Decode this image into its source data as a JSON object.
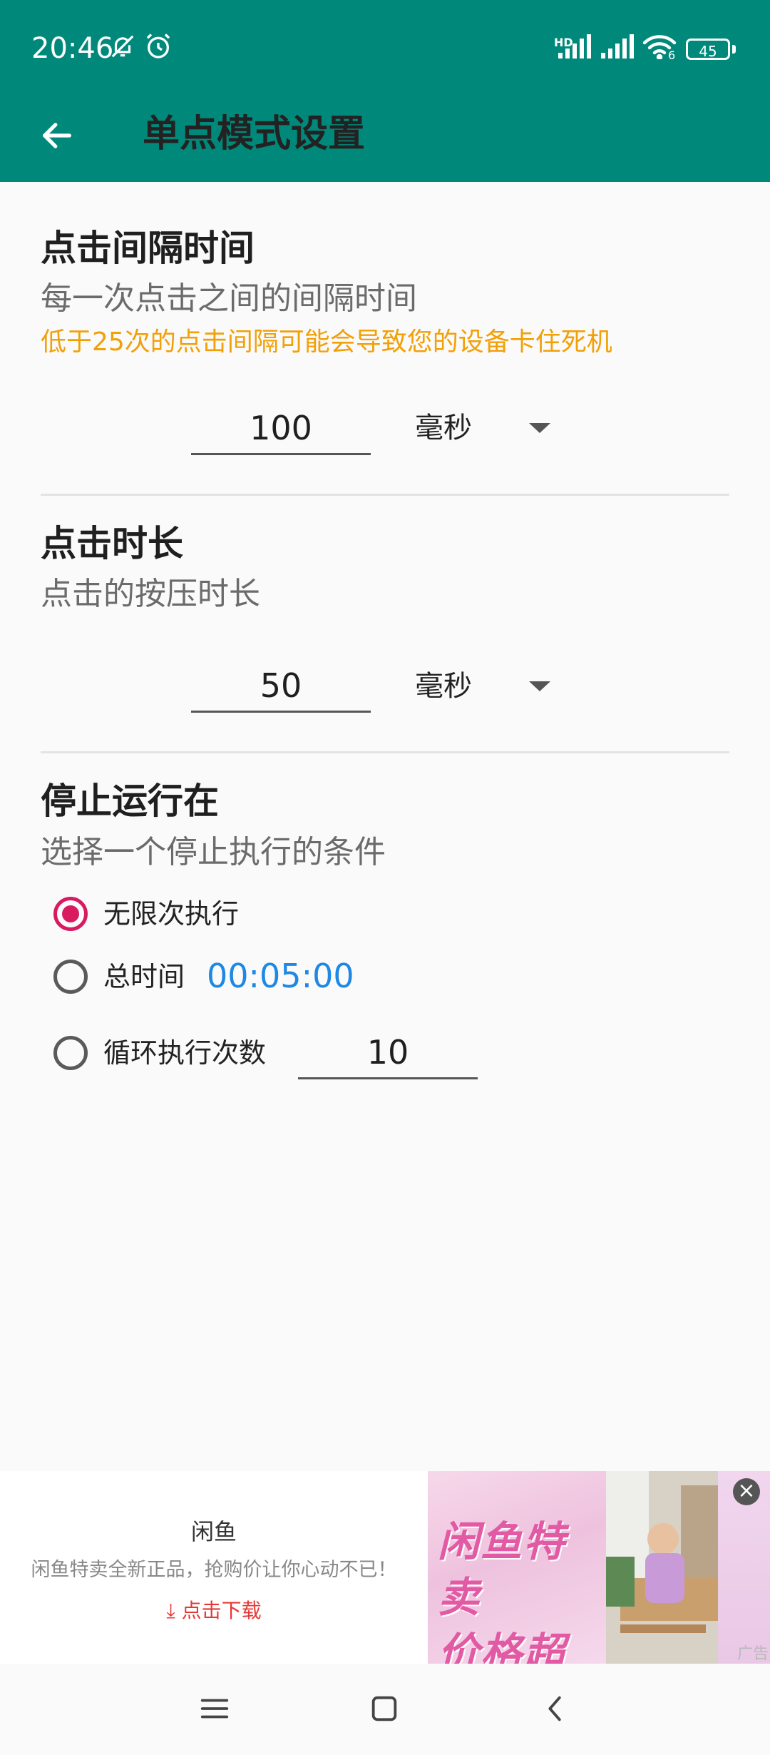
{
  "status_bar": {
    "time": "20:46",
    "battery": "45",
    "hd": "HD",
    "wifi_badge": "6"
  },
  "app_bar": {
    "title": "单点模式设置"
  },
  "interval": {
    "title": "点击间隔时间",
    "subtitle": "每一次点击之间的间隔时间",
    "warning": "低于25次的点击间隔可能会导致您的设备卡住死机",
    "value": "100",
    "unit": "毫秒"
  },
  "duration": {
    "title": "点击时长",
    "subtitle": "点击的按压时长",
    "value": "50",
    "unit": "毫秒"
  },
  "stop": {
    "title": "停止运行在",
    "subtitle": "选择一个停止执行的条件",
    "options": [
      {
        "label": "无限次执行",
        "selected": true
      },
      {
        "label": "总时间",
        "selected": false,
        "value": "00:05:00"
      },
      {
        "label": "循环执行次数",
        "selected": false,
        "value": "10"
      }
    ]
  },
  "ad": {
    "title": "闲鱼",
    "description": "闲鱼特卖全新正品，抢购价让你心动不已！",
    "cta": "点击下载",
    "image_text_line1": "闲鱼特卖",
    "image_text_line2": "价格超低",
    "tag": "广告",
    "close_glyph": "×"
  },
  "icons": {
    "back": "arrow-back-icon",
    "bell_off": "bell-off-icon",
    "alarm": "alarm-icon",
    "signal": "signal-icon",
    "wifi": "wifi-icon",
    "dropdown": "caret-down-icon",
    "nav_menu": "menu-icon",
    "nav_home": "home-square-icon",
    "nav_back": "chevron-left-icon"
  },
  "colors": {
    "primary": "#00897B",
    "accent_radio": "#D81B60",
    "warning": "#F2A007",
    "time_value": "#1E88E5"
  }
}
